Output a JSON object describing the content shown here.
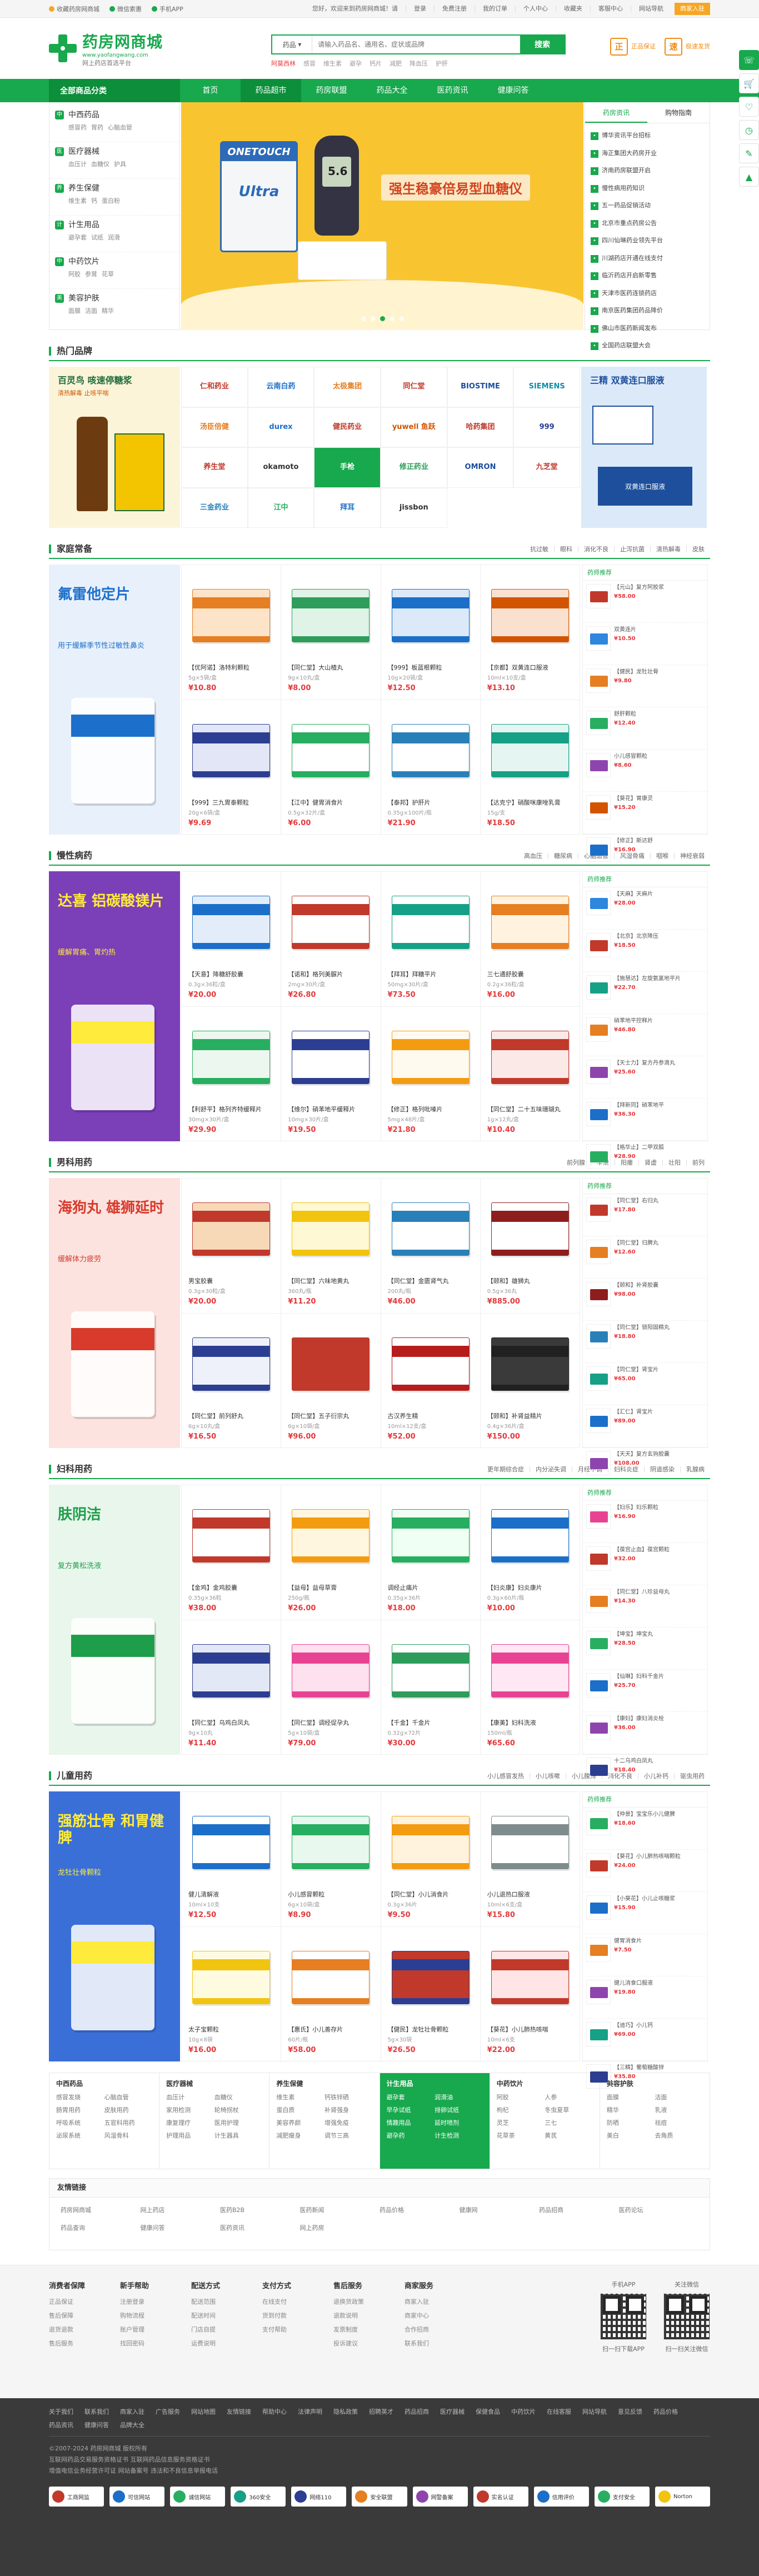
{
  "topbar": {
    "left": [
      {
        "icon": "star-icon",
        "label": "收藏药房网商城",
        "color": "#f5a623"
      },
      {
        "icon": "weixin-icon",
        "label": "微信索惠",
        "color": "#18a84d"
      },
      {
        "icon": "mobile-icon",
        "label": "手机APP",
        "color": "#18a84d"
      }
    ],
    "right": [
      "您好，欢迎来到药房网商城！请",
      "登录",
      "免费注册",
      "我的订单",
      "个人中心",
      "收藏夹",
      "客服中心",
      "网站导航"
    ],
    "register": "商家入驻"
  },
  "logo": {
    "name": "药房网商城",
    "domain": "www.yaofangwang.com",
    "slogan": "网上药店首选平台"
  },
  "search": {
    "category": "药品",
    "placeholder": "请输入药品名、通用名、症状或品牌",
    "button": "搜索",
    "hot": [
      "阿莫西林",
      "感冒",
      "维生素",
      "避孕",
      "钙片",
      "减肥",
      "降血压",
      "护肝"
    ]
  },
  "promise": [
    {
      "icon": "正",
      "text": "正品保证"
    },
    {
      "icon": "速",
      "text": "极速发货"
    }
  ],
  "nav": {
    "all": "全部商品分类",
    "items": [
      "首页",
      "药品超市",
      "药房联盟",
      "药品大全",
      "医药资讯",
      "健康问答"
    ],
    "active": 1
  },
  "categories": [
    {
      "icon": "中",
      "name": "中西药品",
      "subs": [
        "感冒药",
        "胃药",
        "心脑血管"
      ]
    },
    {
      "icon": "医",
      "name": "医疗器械",
      "subs": [
        "血压计",
        "血糖仪",
        "护具"
      ]
    },
    {
      "icon": "养",
      "name": "养生保健",
      "subs": [
        "维生素",
        "钙",
        "蛋白粉"
      ]
    },
    {
      "icon": "计",
      "name": "计生用品",
      "subs": [
        "避孕套",
        "试纸",
        "润滑"
      ]
    },
    {
      "icon": "中",
      "name": "中药饮片",
      "subs": [
        "阿胶",
        "参茸",
        "花草"
      ]
    },
    {
      "icon": "美",
      "name": "美容护肤",
      "subs": [
        "面膜",
        "洁面",
        "精华"
      ]
    }
  ],
  "banner": {
    "brand": "ONETOUCH",
    "product": "Ultra",
    "meter": "5.6",
    "headline": "强生稳豪倍易型血糖仪",
    "active_slide": 2,
    "slides": 5
  },
  "news": {
    "tabs": [
      "药房资讯",
      "购物指南"
    ],
    "items": [
      "博华资讯平台招标",
      "海正集团大药房开业",
      "济南药房联盟开启",
      "慢性病用药知识",
      "五一药品促销活动",
      "北京市重点药房公告",
      "四川仙琳药业领先平台",
      "川湖药店开通在线支付",
      "临沂药店开启新零售",
      "天津市医药连锁药店",
      "南京医药集团药品降价",
      "佛山市医药新闻发布",
      "全国药店联盟大会"
    ]
  },
  "brands": {
    "title": "热门品牌",
    "left_ad": {
      "t1": "百灵鸟 咳速停糖浆",
      "t2": "清热解毒 止咳平喘"
    },
    "cells": [
      "仁和药业",
      "云南白药",
      "太极集团",
      "同仁堂",
      "BIOSTIME",
      "SIEMENS",
      "汤臣倍健",
      "durex",
      "健民药业",
      "yuwell 鱼跃",
      "哈药集团",
      "999",
      "养生堂",
      "okamoto",
      "手枪",
      "修正药业",
      "OMRON",
      "九芝堂",
      "三金药业",
      "江中",
      "拜耳",
      "jissbon"
    ],
    "highlight_index": 14,
    "right_ad": {
      "t1": "三精 双黄连口服液",
      "t2": "双黄连口服液"
    }
  },
  "floors": [
    {
      "title": "家庭常备",
      "tabs": [
        "抗过敏",
        "眼科",
        "消化不良",
        "止泻抗菌",
        "清热解毒",
        "皮肤"
      ],
      "ad": {
        "t1": "氟雷他定片",
        "t2": "用于缓解季节性过敏性鼻炎",
        "bg": "#e8f1fb",
        "c": "#1d6fcc"
      },
      "products": [
        {
          "name": "【优阿诺】洛特利颗粒",
          "spec": "5g×5袋/盒",
          "price": "¥10.80",
          "c1": "#e67e22",
          "c2": "#fde3c7"
        },
        {
          "name": "【同仁堂】大山楂丸",
          "spec": "9g×10丸/盒",
          "price": "¥8.00",
          "c1": "#2e9d5b",
          "c2": "#dff3e6"
        },
        {
          "name": "【999】板蓝根颗粒",
          "spec": "10g×20袋/盒",
          "price": "¥12.50",
          "c1": "#1b6fc9",
          "c2": "#dbe9f8"
        },
        {
          "name": "【京都】双黄连口服液",
          "spec": "10ml×10支/盒",
          "price": "¥13.10",
          "c1": "#d35400",
          "c2": "#fae0cf"
        },
        {
          "name": "【999】三九胃泰颗粒",
          "spec": "20g×6袋/盒",
          "price": "¥9.69",
          "c1": "#2c3e91",
          "c2": "#e2e6f7"
        },
        {
          "name": "【江中】健胃消食片",
          "spec": "0.5g×32片/盒",
          "price": "¥6.00",
          "c1": "#27ae60",
          "c2": "#ffffff"
        },
        {
          "name": "【泰邦】护肝片",
          "spec": "0.35g×100片/瓶",
          "price": "¥21.90",
          "c1": "#2980b9",
          "c2": "#ffffff"
        },
        {
          "name": "【达克宁】硝酸咪康唑乳膏",
          "spec": "15g/支",
          "price": "¥18.50",
          "c1": "#16a085",
          "c2": "#e5f6f2"
        }
      ],
      "side_title": "药师推荐",
      "side": [
        {
          "name": "【元山】复方阿胶浆",
          "price": "¥58.00",
          "c": "#c0392b"
        },
        {
          "name": "双黄连片",
          "price": "¥10.50",
          "c": "#2e86de"
        },
        {
          "name": "【健民】龙牡壮骨",
          "price": "¥9.80",
          "c": "#e67e22"
        },
        {
          "name": "舒肝颗粒",
          "price": "¥12.40",
          "c": "#27ae60"
        },
        {
          "name": "小儿感冒颗粒",
          "price": "¥8.60",
          "c": "#8e44ad"
        },
        {
          "name": "【葵花】胃康灵",
          "price": "¥15.20",
          "c": "#d35400"
        },
        {
          "name": "【修正】斯达舒",
          "price": "¥16.90",
          "c": "#1b6fc9"
        }
      ]
    },
    {
      "title": "慢性病药",
      "tabs": [
        "高血压",
        "糖尿病",
        "心脑血管",
        "风湿骨痛",
        "咽喉",
        "神经衰弱"
      ],
      "ad": {
        "t1": "达喜 铝碳酸镁片",
        "t2": "缓解胃痛、胃灼热",
        "bg": "#7b3fb8",
        "c": "#ffeb3b"
      },
      "products": [
        {
          "name": "【天意】降糖舒胶囊",
          "spec": "0.3g×36粒/盒",
          "price": "¥20.00",
          "c1": "#1b6fc9",
          "c2": "#e3edf9"
        },
        {
          "name": "【诺和】格列美脲片",
          "spec": "2mg×30片/盒",
          "price": "¥26.80",
          "c1": "#c0392b",
          "c2": "#ffffff"
        },
        {
          "name": "【拜耳】拜糖平片",
          "spec": "50mg×30片/盒",
          "price": "¥73.50",
          "c1": "#16a085",
          "c2": "#ffffff"
        },
        {
          "name": "三七通舒胶囊",
          "spec": "0.2g×36粒/盒",
          "price": "¥16.00",
          "c1": "#e67e22",
          "c2": "#fff3e0"
        },
        {
          "name": "【利舒平】格列齐特缓释片",
          "spec": "30mg×30片/盒",
          "price": "¥29.90",
          "c1": "#27ae60",
          "c2": "#ecf8ef"
        },
        {
          "name": "【维尔】硝苯地平缓释片",
          "spec": "10mg×30片/盒",
          "price": "¥19.50",
          "c1": "#2c3e91",
          "c2": "#ffffff"
        },
        {
          "name": "【修正】格列吡嗪片",
          "spec": "5mg×48片/盒",
          "price": "¥21.80",
          "c1": "#f39c12",
          "c2": "#fffaf0"
        },
        {
          "name": "【同仁堂】二十五味珊瑚丸",
          "spec": "1g×12丸/盒",
          "price": "¥10.40",
          "c1": "#c0392b",
          "c2": "#fbe9e7"
        }
      ],
      "side_title": "药师推荐",
      "side": [
        {
          "name": "【天麻】天麻片",
          "price": "¥28.00",
          "c": "#2e86de"
        },
        {
          "name": "【北京】北京降压",
          "price": "¥18.50",
          "c": "#c0392b"
        },
        {
          "name": "【施慧达】左旋氨氯地平片",
          "price": "¥22.70",
          "c": "#16a085"
        },
        {
          "name": "硝苯地平控释片",
          "price": "¥46.80",
          "c": "#e67e22"
        },
        {
          "name": "【天士力】复方丹参滴丸",
          "price": "¥25.60",
          "c": "#8e44ad"
        },
        {
          "name": "【拜新同】硝苯地平",
          "price": "¥36.30",
          "c": "#1b6fc9"
        },
        {
          "name": "【格华止】二甲双胍",
          "price": "¥28.90",
          "c": "#27ae60"
        }
      ]
    },
    {
      "title": "男科用药",
      "tabs": [
        "前列腺",
        "早泄",
        "阳痿",
        "肾虚",
        "壮阳",
        "前列"
      ],
      "ad": {
        "t1": "海狗丸 雄狮延时",
        "t2": "缓解体力疲劳",
        "bg": "#fce3df",
        "c": "#d83a2b"
      },
      "products": [
        {
          "name": "男宝胶囊",
          "spec": "0.3g×30粒/盒",
          "price": "¥20.00",
          "c1": "#c0392b",
          "c2": "#f7d9b8"
        },
        {
          "name": "【同仁堂】六味地黄丸",
          "spec": "360丸/瓶",
          "price": "¥11.20",
          "c1": "#f1c40f",
          "c2": "#fff8d5"
        },
        {
          "name": "【同仁堂】金匮肾气丸",
          "spec": "200丸/瓶",
          "price": "¥46.00",
          "c1": "#2980b9",
          "c2": "#ffffff"
        },
        {
          "name": "【颐和】雄狮丸",
          "spec": "0.5g×36丸",
          "price": "¥885.00",
          "c1": "#8e1e1e",
          "c2": "#ffffff"
        },
        {
          "name": "【同仁堂】前列舒丸",
          "spec": "6g×10丸/盒",
          "price": "¥16.50",
          "c1": "#2c3e91",
          "c2": "#eef1fa"
        },
        {
          "name": "【同仁堂】五子衍宗丸",
          "spec": "6g×10袋/盒",
          "price": "¥96.00",
          "c1": "#c0392b",
          "c2": "#c0392b"
        },
        {
          "name": "古汉养生精",
          "spec": "10ml×12支/盒",
          "price": "¥52.00",
          "c1": "#b71c1c",
          "c2": "#fff"
        },
        {
          "name": "【颐和】补肾益精片",
          "spec": "0.4g×36片/盒",
          "price": "¥150.00",
          "c1": "#212121",
          "c2": "#3a3a3a"
        }
      ],
      "side_title": "药师推荐",
      "side": [
        {
          "name": "【同仁堂】右归丸",
          "price": "¥17.80",
          "c": "#c0392b"
        },
        {
          "name": "【同仁堂】归脾丸",
          "price": "¥12.60",
          "c": "#e67e22"
        },
        {
          "name": "【颐和】补肾胶囊",
          "price": "¥98.00",
          "c": "#8e1e1e"
        },
        {
          "name": "【同仁堂】锁阳固精丸",
          "price": "¥18.80",
          "c": "#2980b9"
        },
        {
          "name": "【同仁堂】肾宝片",
          "price": "¥65.00",
          "c": "#16a085"
        },
        {
          "name": "【汇仁】肾宝片",
          "price": "¥89.00",
          "c": "#1b6fc9"
        },
        {
          "name": "【天天】复方玄驹胶囊",
          "price": "¥108.00",
          "c": "#8e44ad"
        }
      ]
    },
    {
      "title": "妇科用药",
      "tabs": [
        "更年期综合症",
        "内分泌失调",
        "月经不调",
        "妇科炎症",
        "阴道感染",
        "乳腺病"
      ],
      "ad": {
        "t1": "肤阴洁",
        "t2": "复方黄松洗液",
        "bg": "#e8f6ec",
        "c": "#1e9e4a"
      },
      "products": [
        {
          "name": "【金鸡】金鸡胶囊",
          "spec": "0.35g×36粒",
          "price": "¥38.00",
          "c1": "#c0392b",
          "c2": "#ffffff"
        },
        {
          "name": "【益母】益母草膏",
          "spec": "250g/瓶",
          "price": "¥26.00",
          "c1": "#f39c12",
          "c2": "#fff6e0"
        },
        {
          "name": "调经止痛片",
          "spec": "0.35g×36片",
          "price": "¥18.00",
          "c1": "#27ae60",
          "c2": "#f0fff3"
        },
        {
          "name": "【妇炎康】妇炎康片",
          "spec": "0.3g×60片/瓶",
          "price": "¥10.00",
          "c1": "#1b6fc9",
          "c2": "#ffffff"
        },
        {
          "name": "【同仁堂】乌鸡白凤丸",
          "spec": "9g×10丸",
          "price": "¥11.40",
          "c1": "#2c3e91",
          "c2": "#e3e8f7"
        },
        {
          "name": "【同仁堂】调经促孕丸",
          "spec": "5g×10袋/盒",
          "price": "¥79.00",
          "c1": "#e84393",
          "c2": "#fde1ee"
        },
        {
          "name": "【千金】千金片",
          "spec": "0.32g×72片",
          "price": "¥30.00",
          "c1": "#2e9d5b",
          "c2": "#ffffff"
        },
        {
          "name": "【康美】妇科洗液",
          "spec": "150ml/瓶",
          "price": "¥65.60",
          "c1": "#e84393",
          "c2": "#ffe8f3"
        }
      ],
      "side_title": "药师推荐",
      "side": [
        {
          "name": "【妇乐】妇乐颗粒",
          "price": "¥16.90",
          "c": "#e84393"
        },
        {
          "name": "【葆宫止血】葆宫颗粒",
          "price": "¥32.00",
          "c": "#c0392b"
        },
        {
          "name": "【同仁堂】八珍益母丸",
          "price": "¥14.30",
          "c": "#e67e22"
        },
        {
          "name": "【坤宝】坤宝丸",
          "price": "¥28.50",
          "c": "#27ae60"
        },
        {
          "name": "【仙琳】妇科千金片",
          "price": "¥25.70",
          "c": "#1b6fc9"
        },
        {
          "name": "【康妇】康妇消炎栓",
          "price": "¥36.00",
          "c": "#8e44ad"
        },
        {
          "name": "十二乌鸡白凤丸",
          "price": "¥18.40",
          "c": "#2c3e91"
        }
      ]
    },
    {
      "title": "儿童用药",
      "tabs": [
        "小儿感冒发热",
        "小儿咳嗽",
        "小儿腹泻",
        "消化不良",
        "小儿补钙",
        "驱虫用药"
      ],
      "ad": {
        "t1": "强筋壮骨 和胃健脾",
        "t2": "龙牡壮骨颗粒",
        "bg": "#3a6fd8",
        "c": "#ffeb3b"
      },
      "products": [
        {
          "name": "健儿清解液",
          "spec": "10ml×10支",
          "price": "¥12.50",
          "c1": "#1b6fc9",
          "c2": "#ffffff"
        },
        {
          "name": "小儿感冒颗粒",
          "spec": "6g×10袋/盒",
          "price": "¥8.90",
          "c1": "#27ae60",
          "c2": "#e8f8ee"
        },
        {
          "name": "【同仁堂】小儿消食片",
          "spec": "0.3g×36片",
          "price": "¥9.50",
          "c1": "#f39c12",
          "c2": "#fff3dd"
        },
        {
          "name": "小儿退热口服液",
          "spec": "10ml×6支/盒",
          "price": "¥15.80",
          "c1": "#7f8c8d",
          "c2": "#ffffff"
        },
        {
          "name": "太子宝颗粒",
          "spec": "10g×8袋",
          "price": "¥16.00",
          "c1": "#f1c40f",
          "c2": "#fffbe0"
        },
        {
          "name": "【惠氏】小儿善存片",
          "spec": "60片/瓶",
          "price": "¥58.00",
          "c1": "#e67e22",
          "c2": "#ffffff"
        },
        {
          "name": "【健民】龙牡壮骨颗粒",
          "spec": "5g×30袋",
          "price": "¥26.50",
          "c1": "#2c3e91",
          "c2": "#c0392b"
        },
        {
          "name": "【葵花】小儿肺热咳喘",
          "spec": "10ml×6支",
          "price": "¥22.00",
          "c1": "#c0392b",
          "c2": "#ffe5e5"
        }
      ],
      "side_title": "药师推荐",
      "side": [
        {
          "name": "【仲景】宝宝乐小儿健脾",
          "price": "¥18.60",
          "c": "#27ae60"
        },
        {
          "name": "【葵花】小儿肺热咳喘颗粒",
          "price": "¥24.00",
          "c": "#c0392b"
        },
        {
          "name": "【小葵花】小儿止咳糖浆",
          "price": "¥15.90",
          "c": "#1b6fc9"
        },
        {
          "name": "健胃消食片",
          "price": "¥7.50",
          "c": "#e67e22"
        },
        {
          "name": "健儿消食口服液",
          "price": "¥19.80",
          "c": "#8e44ad"
        },
        {
          "name": "【迪巧】小儿钙",
          "price": "¥69.00",
          "c": "#16a085"
        },
        {
          "name": "【三精】葡萄糖酸锌",
          "price": "¥35.80",
          "c": "#2c3e91"
        }
      ]
    }
  ],
  "cat_table": [
    {
      "title": "中西药品",
      "links": [
        "感冒发烧",
        "心脑血管",
        "肠胃用药",
        "皮肤用药",
        "呼吸系统",
        "五官科用药",
        "泌尿系统",
        "风湿骨科"
      ]
    },
    {
      "title": "医疗器械",
      "links": [
        "血压计",
        "血糖仪",
        "家用检测",
        "轮椅拐杖",
        "康复理疗",
        "医用护理",
        "护理用品",
        "计生器具"
      ]
    },
    {
      "title": "养生保健",
      "links": [
        "维生素",
        "钙铁锌硒",
        "蛋白质",
        "补肾强身",
        "美容养颜",
        "增强免疫",
        "减肥瘦身",
        "调节三高"
      ]
    },
    {
      "title": "计生用品",
      "links": [
        "避孕套",
        "润滑油",
        "早孕试纸",
        "排卵试纸",
        "情趣用品",
        "延时喷剂",
        "避孕药",
        "计生检测"
      ],
      "hl": true
    },
    {
      "title": "中药饮片",
      "links": [
        "阿胶",
        "人参",
        "枸杞",
        "冬虫夏草",
        "灵芝",
        "三七",
        "花草茶",
        "黄芪"
      ]
    },
    {
      "title": "美容护肤",
      "links": [
        "面膜",
        "洁面",
        "精华",
        "乳液",
        "防晒",
        "祛痘",
        "美白",
        "去角质"
      ]
    }
  ],
  "friend": {
    "title": "友情链接",
    "links": [
      "药房网商城",
      "网上药店",
      "医药B2B",
      "医药新闻",
      "药品价格",
      "健康网",
      "药品招商",
      "医药论坛",
      "药品查询",
      "健康问答",
      "医药资讯",
      "网上药房"
    ]
  },
  "help": [
    {
      "title": "消费者保障",
      "items": [
        "正品保证",
        "售后保障",
        "退货退款",
        "售后服务"
      ]
    },
    {
      "title": "新手帮助",
      "items": [
        "注册登录",
        "购物流程",
        "账户管理",
        "找回密码"
      ]
    },
    {
      "title": "配送方式",
      "items": [
        "配送范围",
        "配送时间",
        "门店自提",
        "运费说明"
      ]
    },
    {
      "title": "支付方式",
      "items": [
        "在线支付",
        "货到付款",
        "支付帮助"
      ]
    },
    {
      "title": "售后服务",
      "items": [
        "退换货政策",
        "退款说明",
        "发票制度",
        "投诉建议"
      ]
    },
    {
      "title": "商家服务",
      "items": [
        "商家入驻",
        "商家中心",
        "合作招商",
        "联系我们"
      ]
    }
  ],
  "qr": [
    {
      "title": "手机APP",
      "caption": "扫一扫下载APP"
    },
    {
      "title": "关注微信",
      "caption": "扫一扫关注微信"
    }
  ],
  "footer": {
    "links": [
      "关于我们",
      "联系我们",
      "商家入驻",
      "广告服务",
      "网站地图",
      "友情链接",
      "帮助中心",
      "法律声明",
      "隐私政策",
      "招聘英才",
      "药品招商",
      "医疗器械",
      "保健食品",
      "中药饮片",
      "在线客服",
      "网站导航",
      "意见反馈",
      "药品价格",
      "药品资讯",
      "健康问答",
      "品牌大全"
    ],
    "copy": [
      "©2007-2024 药房网商城 版权所有",
      "互联网药品交易服务资格证书 互联网药品信息服务资格证书",
      "增值电信业务经营许可证 网站备案号 违法和不良信息举报电话"
    ],
    "certs": [
      {
        "t": "工商网监",
        "c": "#c0392b"
      },
      {
        "t": "可信网站",
        "c": "#1b6fc9"
      },
      {
        "t": "诚信网站",
        "c": "#27ae60"
      },
      {
        "t": "360安全",
        "c": "#16a085"
      },
      {
        "t": "网络110",
        "c": "#2c3e91"
      },
      {
        "t": "安全联盟",
        "c": "#e67e22"
      },
      {
        "t": "网警备案",
        "c": "#8e44ad"
      },
      {
        "t": "实名认证",
        "c": "#c0392b"
      },
      {
        "t": "信用评价",
        "c": "#1b6fc9"
      },
      {
        "t": "支付安全",
        "c": "#27ae60"
      },
      {
        "t": "Norton",
        "c": "#f1c40f"
      }
    ]
  },
  "rside": [
    "客服",
    "购物车",
    "收藏",
    "足迹",
    "反馈",
    "顶部"
  ]
}
